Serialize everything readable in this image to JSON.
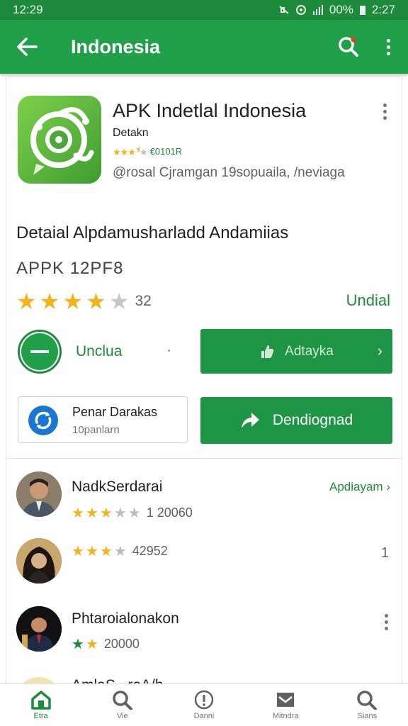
{
  "status_bar": {
    "time_left": "12:29",
    "battery": "00%",
    "time_right": "2:27"
  },
  "app_bar": {
    "title": "Indonesia"
  },
  "app": {
    "name": "APK Indetlal Indonesia",
    "developer": "Detakn",
    "mini_rating_text": "€0101R",
    "mini_rating": 3.5,
    "info": "@rosal Cjramgan 19sopuaila, /neviaga"
  },
  "details": {
    "title": "Detaial Alpdamusharladd Andamiias",
    "apk_size": "APPK 12PF8",
    "rating": 4,
    "rating_count": "32",
    "link": "Undial",
    "uninstall_label": "Unclua",
    "action_button": "Adtayka",
    "pena_title": "Penar Darakas",
    "pena_subtitle": "10panlarn",
    "download_button": "Dendiognad"
  },
  "reviews": [
    {
      "name": "NadkSerdarai",
      "rating": 3,
      "count": "1 20060",
      "link": "Apdiayam"
    },
    {
      "name": "",
      "rating": 3,
      "count": "42952",
      "side_number": "1"
    },
    {
      "name": "Phtaroialonakon",
      "rating": 2,
      "count": "20000"
    },
    {
      "name": "AmlaS...roA/h"
    }
  ],
  "bottom_nav": [
    {
      "label": "Etra",
      "icon": "home-icon",
      "active": true
    },
    {
      "label": "Vie",
      "icon": "search-icon",
      "active": false
    },
    {
      "label": "Danni",
      "icon": "info-icon",
      "active": false
    },
    {
      "label": "Mitndra",
      "icon": "mail-icon",
      "active": false
    },
    {
      "label": "Sians",
      "icon": "search-icon",
      "active": false
    }
  ],
  "colors": {
    "primary": "#21a04a",
    "primary_dark": "#1e8a3c",
    "star": "#f5b31b"
  }
}
